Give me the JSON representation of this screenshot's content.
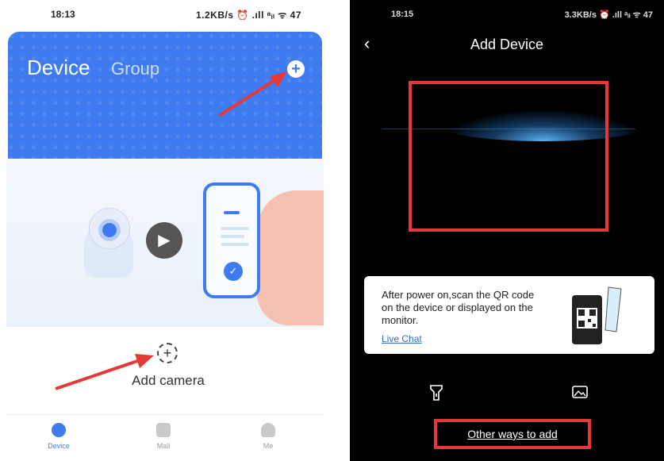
{
  "left_screen": {
    "status_bar": {
      "time": "18:13",
      "indicators": "1.2KB/s ⏰ .ıll ᵃᵢₗ ᯤ 47"
    },
    "header": {
      "tab_device": "Device",
      "tab_group": "Group",
      "add_icon": "plus-circle-icon"
    },
    "add_camera": {
      "label": "Add camera",
      "icon": "dashed-plus-icon"
    },
    "bottom_nav": [
      {
        "label": "Device",
        "icon": "camera-icon",
        "active": true
      },
      {
        "label": "Mall",
        "icon": "bag-icon",
        "active": false
      },
      {
        "label": "Me",
        "icon": "person-icon",
        "active": false
      }
    ],
    "accent_color": "#3f7bf0"
  },
  "right_screen": {
    "status_bar": {
      "time": "18:15",
      "indicators": "3.3KB/s ⏰ .ıll ᵃᵢₗ ᯤ 47"
    },
    "title": "Add Device",
    "back_icon": "chevron-left-icon",
    "info_card": {
      "text": "After power on,scan the QR code on the device or displayed on the monitor.",
      "link": "Live Chat"
    },
    "tools": {
      "flashlight_icon": "flashlight-icon",
      "album_icon": "album-icon"
    },
    "other_ways": "Other ways to add",
    "highlight_color": "#e53935"
  }
}
